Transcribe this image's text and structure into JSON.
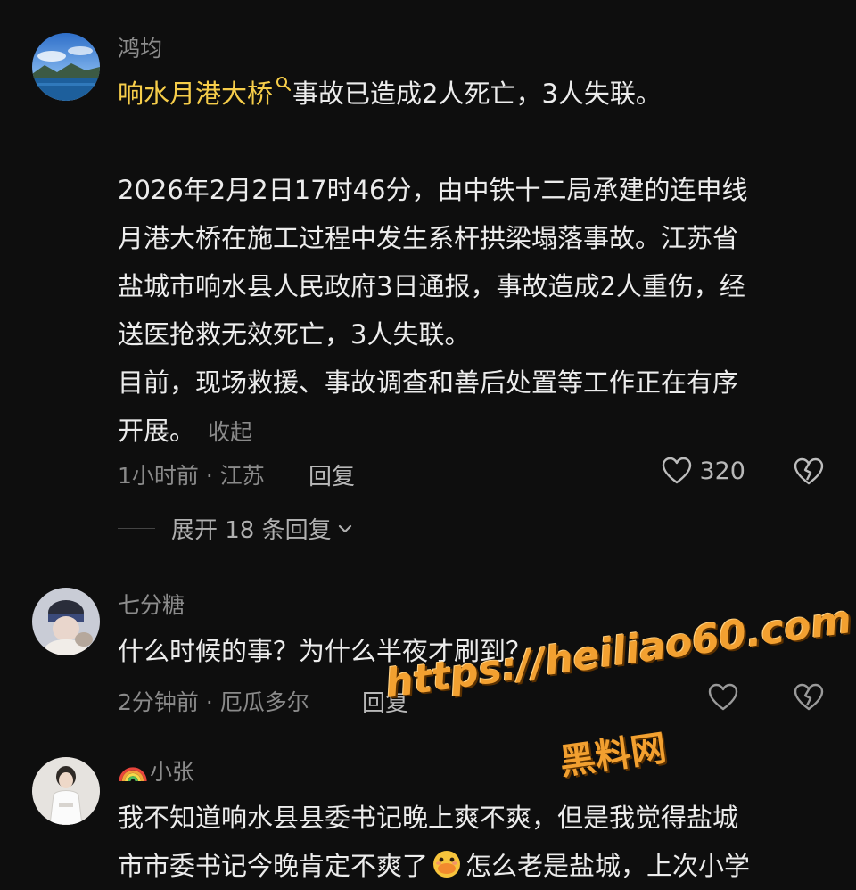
{
  "comments": [
    {
      "username": "鸿均",
      "link_text": "响水月港大桥",
      "lines": [
        "事故已造成2人死亡，3人失联。",
        "",
        "2026年2月2日17时46分，由中铁十二局承建的连申线",
        "月港大桥在施工过程中发生系杆拱梁塌落事故。江苏省",
        "盐城市响水县人民政府3日通报，事故造成2人重伤，经",
        "送医抢救无效死亡，3人失联。",
        "目前，现场救援、事故调查和善后处置等工作正在有序",
        "开展。"
      ],
      "collapse_label": "收起",
      "meta": "1小时前 · 江苏",
      "reply_label": "回复",
      "likes": "320",
      "expand_label": "展开 18 条回复"
    },
    {
      "username": "七分糖",
      "lines": [
        "什么时候的事？为什么半夜才刷到？"
      ],
      "meta": "2分钟前 · 厄瓜多尔",
      "reply_label": "回复"
    },
    {
      "username": "小张",
      "lines": [
        "我不知道响水县县委书记晚上爽不爽，但是我觉得盐城",
        "市市委书记今晚肯定不爽了",
        "怎么老是盐城，上次小学"
      ]
    }
  ],
  "watermark": {
    "url": "https://heiliao60.com",
    "name": "黑料网"
  },
  "colors": {
    "background": "#0e0e0e",
    "link": "#f6cd4a",
    "watermark": "#f2a030"
  }
}
